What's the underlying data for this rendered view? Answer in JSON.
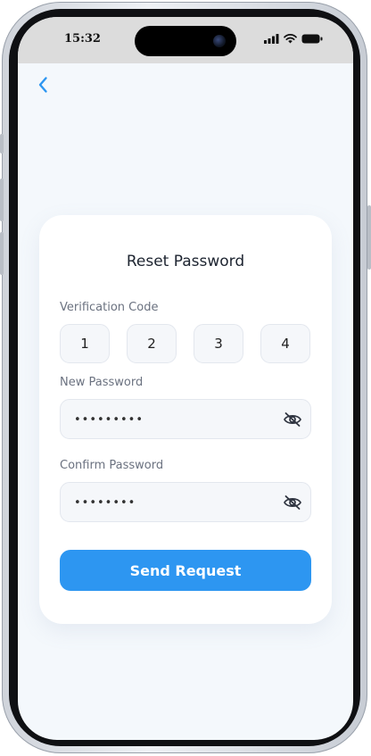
{
  "status_bar": {
    "time": "15:32",
    "icons": [
      "signal-icon",
      "wifi-icon",
      "battery-icon"
    ]
  },
  "nav": {
    "back_icon": "chevron-left-icon"
  },
  "card": {
    "title": "Reset Password",
    "verification": {
      "label": "Verification Code",
      "digits": [
        "1",
        "2",
        "3",
        "4"
      ]
    },
    "new_password": {
      "label": "New Password",
      "value": "•••••••••",
      "toggle_icon": "eye-off-icon"
    },
    "confirm_password": {
      "label": "Confirm Password",
      "value": "••••••••",
      "toggle_icon": "eye-off-icon"
    },
    "submit_label": "Send Request"
  },
  "colors": {
    "accent": "#2d96f1",
    "screen_background": "#f4f8fc",
    "card_background": "#ffffff",
    "field_background": "#f5f7fa",
    "title_text": "#1d2430",
    "label_text": "#6b7280"
  }
}
